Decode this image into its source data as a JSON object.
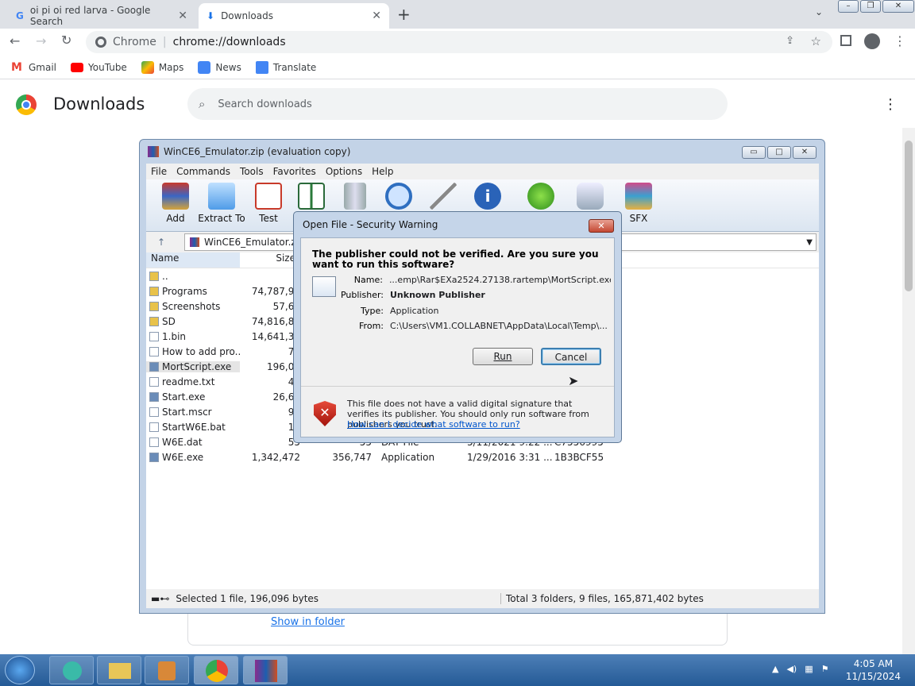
{
  "browser": {
    "tabs": [
      {
        "label": "oi pi oi red larva - Google Search"
      },
      {
        "label": "Downloads"
      }
    ],
    "omnibox_site": "Chrome",
    "omnibox_url": "chrome://downloads"
  },
  "bookmarks": [
    {
      "label": "Gmail"
    },
    {
      "label": "YouTube"
    },
    {
      "label": "Maps"
    },
    {
      "label": "News"
    },
    {
      "label": "Translate"
    }
  ],
  "downloads": {
    "title": "Downloads",
    "search_placeholder": "Search downloads",
    "show_in_folder": "Show in folder"
  },
  "winrar": {
    "title": "WinCE6_Emulator.zip (evaluation copy)",
    "menu": [
      "File",
      "Commands",
      "Tools",
      "Favorites",
      "Options",
      "Help"
    ],
    "tools": [
      "Add",
      "Extract To",
      "Test",
      "",
      "",
      "",
      "",
      "",
      "",
      "",
      "SFX"
    ],
    "path": "WinCE6_Emulator.zip",
    "columns": [
      "Name",
      "Size"
    ],
    "rows": [
      {
        "name": "..",
        "size": "",
        "packed": "",
        "type": "",
        "modified": "",
        "crc": ""
      },
      {
        "name": "Programs",
        "size": "74,787,96",
        "packed": "",
        "type": "",
        "modified": "",
        "crc": ""
      },
      {
        "name": "Screenshots",
        "size": "57,62",
        "packed": "",
        "type": "",
        "modified": "",
        "crc": ""
      },
      {
        "name": "SD",
        "size": "74,816,89",
        "packed": "",
        "type": "",
        "modified": "",
        "crc": ""
      },
      {
        "name": "1.bin",
        "size": "14,641,36",
        "packed": "",
        "type": "",
        "modified": "",
        "crc": ""
      },
      {
        "name": "How to add pro...",
        "size": "77",
        "packed": "",
        "type": "",
        "modified": "",
        "crc": ""
      },
      {
        "name": "MortScript.exe",
        "size": "196,09",
        "packed": "",
        "type": "",
        "modified": "",
        "crc": ""
      },
      {
        "name": "readme.txt",
        "size": "45",
        "packed": "",
        "type": "",
        "modified": "",
        "crc": ""
      },
      {
        "name": "Start.exe",
        "size": "26,62",
        "packed": "",
        "type": "",
        "modified": "",
        "crc": ""
      },
      {
        "name": "Start.mscr",
        "size": "97",
        "packed": "",
        "type": "",
        "modified": "",
        "crc": ""
      },
      {
        "name": "StartW6E.bat",
        "size": "12",
        "packed": "",
        "type": "",
        "modified": "",
        "crc": ""
      },
      {
        "name": "W6E.dat",
        "size": "55",
        "packed": "55",
        "type": "DAT File",
        "modified": "5/11/2021 9:22 ...",
        "crc": "C7556995"
      },
      {
        "name": "W6E.exe",
        "size": "1,342,472",
        "packed": "356,747",
        "type": "Application",
        "modified": "1/29/2016 3:31 ...",
        "crc": "1B3BCF55"
      }
    ],
    "status_left": "Selected 1 file, 196,096 bytes",
    "status_right": "Total 3 folders, 9 files, 165,871,402 bytes"
  },
  "dialog": {
    "title": "Open File - Security Warning",
    "question": "The publisher could not be verified.  Are you sure you want to run this software?",
    "name_label": "Name:",
    "name": "...emp\\Rar$EXa2524.27138.rartemp\\MortScript.exe",
    "publisher_label": "Publisher:",
    "publisher": "Unknown Publisher",
    "type_label": "Type:",
    "type": "Application",
    "from_label": "From:",
    "from": "C:\\Users\\VM1.COLLABNET\\AppData\\Local\\Temp\\...",
    "run": "Run",
    "cancel": "Cancel",
    "warning": "This file does not have a valid digital signature that verifies its publisher.  You should only run software from publishers you trust.",
    "link": "How can I decide what software to run?"
  },
  "taskbar": {
    "time": "4:05 AM",
    "date": "11/15/2024"
  }
}
